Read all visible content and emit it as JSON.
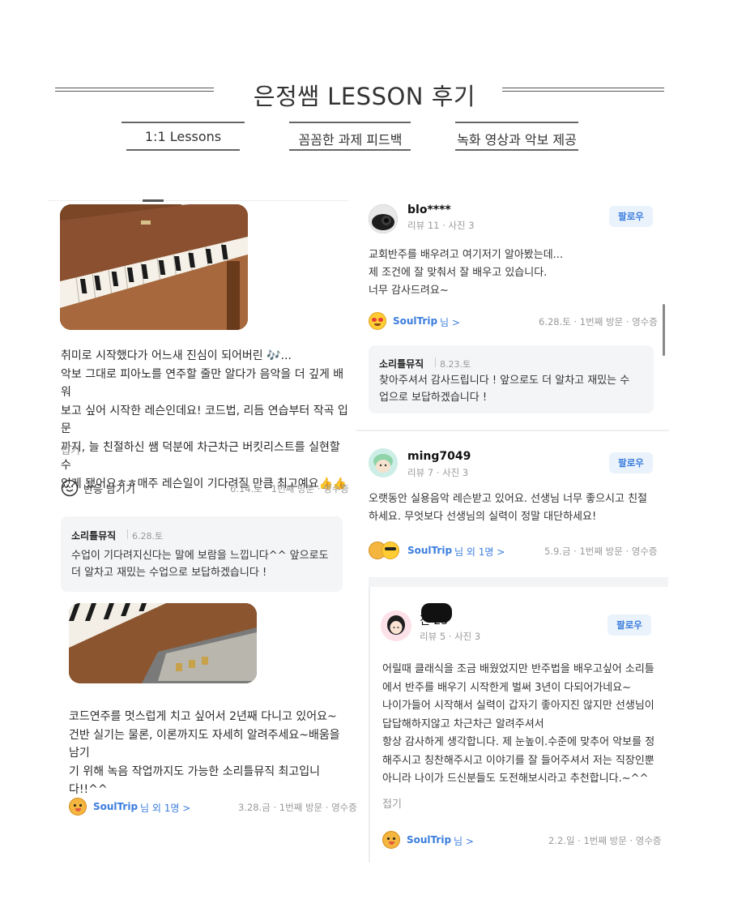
{
  "header": {
    "title": "은정쌤 LESSON 후기",
    "tags": [
      "1:1 Lessons",
      "꼼꼼한 과제 피드백",
      "녹화 영상과 악보 제공"
    ]
  },
  "left": {
    "review1": {
      "text": "취미로 시작했다가 어느새 진심이 되어버린 🎶...\n악보 그대로 피아노를 연주할 줄만 알다가 음악을 더 깊게 배워\n보고 싶어 시작한 레슨인데요! 코드법, 리듬 연습부터 작곡 입문\n까지, 늘 친절하신 쌤 덕분에 차근차근 버킷리스트를 실현할 수\n있게 됐어요ㅎㅎ매주 레슨일이 기다려질 만큼 최고예요👍👍",
      "fold": "접기",
      "react": "반응 남기기",
      "meta": "6.14.토 · 1번째 방문 · 영수증",
      "reply": {
        "name": "소리틀뮤직",
        "date": "6.28.토",
        "text": "수업이 기다려지신다는 말에 보람을 느낍니다^^ 앞으로도\n더 알차고 재밌는 수업으로 보답하겠습니다 !"
      }
    },
    "review2": {
      "text": "코드연주를 멋스럽게 치고 싶어서 2년째 다니고 있어요~\n건반 실기는 물론, 이론까지도 자세히 알려주세요~배움을 남기\n기 위해 녹음 작업까지도 가능한 소리틀뮤직 최고입니다!!^^",
      "soul": "SoulTrip",
      "soul_suffix": "님 외 1명 >",
      "meta": "3.28.금 · 1번째 방문 · 영수증"
    }
  },
  "right": {
    "review1": {
      "user": "blo****",
      "stats": "리뷰 11 · 사진 3",
      "follow": "팔로우",
      "text": "교회반주를 배우려고 여기저기 알아봤는데...\n제 조건에 잘 맞춰서 잘 배우고 있습니다.\n너무 감사드려요~",
      "soul": "SoulTrip",
      "soul_suffix": "님 >",
      "meta": "6.28.토 · 1번째 방문 · 영수증",
      "reply": {
        "name": "소리틀뮤직",
        "date": "8.23.토",
        "text": "찾아주셔서 감사드립니다 ! 앞으로도 더 알차고 재밌는 수\n업으로 보답하겠습니다 !"
      }
    },
    "review2": {
      "user": "ming7049",
      "stats": "리뷰 7 · 사진 3",
      "follow": "팔로우",
      "text": "오랫동안 실용음악 레슨받고 있어요. 선생님 너무 좋으시고 친절\n하세요. 무엇보다 선생님의 실력이 정말 대단하세요!",
      "soul": "SoulTrip",
      "soul_suffix": "님 외 1명 >",
      "meta": "5.9.금 · 1번째 방문 · 영수증"
    },
    "review3": {
      "user": "진  23",
      "stats": "리뷰 5 · 사진 3",
      "follow": "팔로우",
      "text": "어릴때 클래식을 조금 배웠었지만 반주법을 배우고싶어 소리틀\n에서 반주를 배우기 시작한게 벌써 3년이 다되어가네요~\n나이가들어 시작해서 실력이 갑자기 좋아지진 않지만 선생님이\n답답해하지않고 차근차근 알려주셔서\n항상 감사하게 생각합니다. 제 눈높이.수준에 맞추어 악보를 정\n해주시고 칭찬해주시고 이야기를 잘 들어주셔서 저는 직장인뿐\n아니라 나이가 드신분들도 도전해보시라고 추천합니다.~^^",
      "fold": "접기",
      "soul": "SoulTrip",
      "soul_suffix": "님 >",
      "meta": "2.2.일 · 1번째 방문 · 영수증"
    }
  },
  "colors": {
    "accent": "#3b7ddd",
    "follow_bg": "#eaf2fc",
    "reply_bg": "#f4f5f7"
  }
}
